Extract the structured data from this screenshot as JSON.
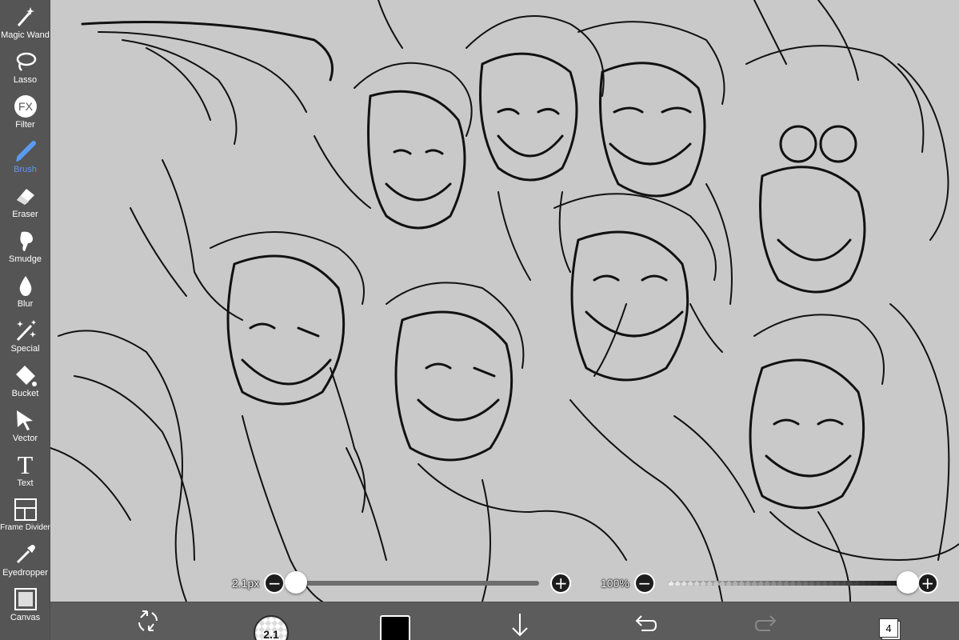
{
  "toolbar": {
    "tools": [
      {
        "label": "Magic Wand",
        "icon": "magic-wand-icon"
      },
      {
        "label": "Lasso",
        "icon": "lasso-icon"
      },
      {
        "label": "Filter",
        "icon": "fx-filter-icon",
        "glyph": "FX"
      },
      {
        "label": "Brush",
        "icon": "brush-icon",
        "active": true
      },
      {
        "label": "Eraser",
        "icon": "eraser-icon"
      },
      {
        "label": "Smudge",
        "icon": "smudge-icon"
      },
      {
        "label": "Blur",
        "icon": "blur-drop-icon"
      },
      {
        "label": "Special",
        "icon": "special-sparkle-icon"
      },
      {
        "label": "Bucket",
        "icon": "bucket-icon"
      },
      {
        "label": "Vector",
        "icon": "vector-arrow-icon"
      },
      {
        "label": "Text",
        "icon": "text-icon",
        "glyph": "T"
      },
      {
        "label": "Frame Divider",
        "icon": "frame-divider-icon"
      },
      {
        "label": "Eyedropper",
        "icon": "eyedropper-icon"
      },
      {
        "label": "Canvas",
        "icon": "canvas-icon"
      }
    ]
  },
  "sliders": {
    "brush_size": {
      "value_text": "2.1px",
      "minus": "−",
      "plus": "+",
      "fraction": 0.0
    },
    "opacity": {
      "value_text": "100%",
      "minus": "−",
      "plus": "+",
      "fraction": 1.0
    }
  },
  "bottombar": {
    "brush_preview_text": "2.1",
    "current_color": "#000000",
    "layer_count": "4"
  },
  "colors": {
    "toolbar_bg": "#555555",
    "canvas_bg": "#c9c9c9",
    "active_tool": "#5b9bf0"
  }
}
